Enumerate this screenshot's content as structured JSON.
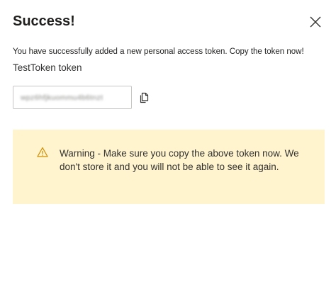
{
  "dialog": {
    "title": "Success!",
    "message": "You have successfully added a new personal access token. Copy the token now!",
    "token_name": "TestToken token",
    "token_value": "wpz6hfjkuommu4b6tnzt",
    "warning": "Warning - Make sure you copy the above token now. We don't store it and you will not be able to see it again."
  },
  "icons": {
    "close": "close-icon",
    "copy": "copy-icon",
    "warning": "warning-icon"
  },
  "colors": {
    "warning_background": "#fff4ce",
    "warning_icon": "#d08c00",
    "text": "#201f1e"
  }
}
